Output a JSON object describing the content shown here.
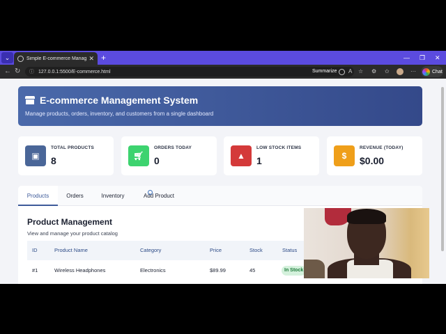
{
  "browser": {
    "tab_title": "Simple E-commerce Management",
    "url": "127.0.0.1:5500/E-commerce.html",
    "summarize_label": "Summarize",
    "chat_label": "Chat",
    "new_tab_glyph": "+",
    "close_glyph": "✕"
  },
  "header": {
    "title": "E-commerce Management System",
    "subtitle": "Manage products, orders, inventory, and customers from a single dashboard"
  },
  "stats": [
    {
      "label": "TOTAL PRODUCTS",
      "value": "8",
      "icon": "box-icon",
      "color": "#4a6698"
    },
    {
      "label": "ORDERS TODAY",
      "value": "0",
      "icon": "cart-icon",
      "color": "#3dd36f"
    },
    {
      "label": "LOW STOCK ITEMS",
      "value": "1",
      "icon": "warning-icon",
      "color": "#d43a3a"
    },
    {
      "label": "REVENUE (TODAY)",
      "value": "$0.00",
      "icon": "dollar-icon",
      "color": "#ef9f1a"
    }
  ],
  "tabs": [
    "Products",
    "Orders",
    "Inventory",
    "Add Product"
  ],
  "active_tab": "Products",
  "products": {
    "title": "Product Management",
    "subtitle": "View and manage your product catalog",
    "columns": [
      "ID",
      "Product Name",
      "Category",
      "Price",
      "Stock",
      "Status"
    ],
    "rows": [
      {
        "id": "#1",
        "name": "Wireless Headphones",
        "category": "Electronics",
        "price": "$89.99",
        "stock": "45",
        "status": "In Stock"
      }
    ]
  }
}
